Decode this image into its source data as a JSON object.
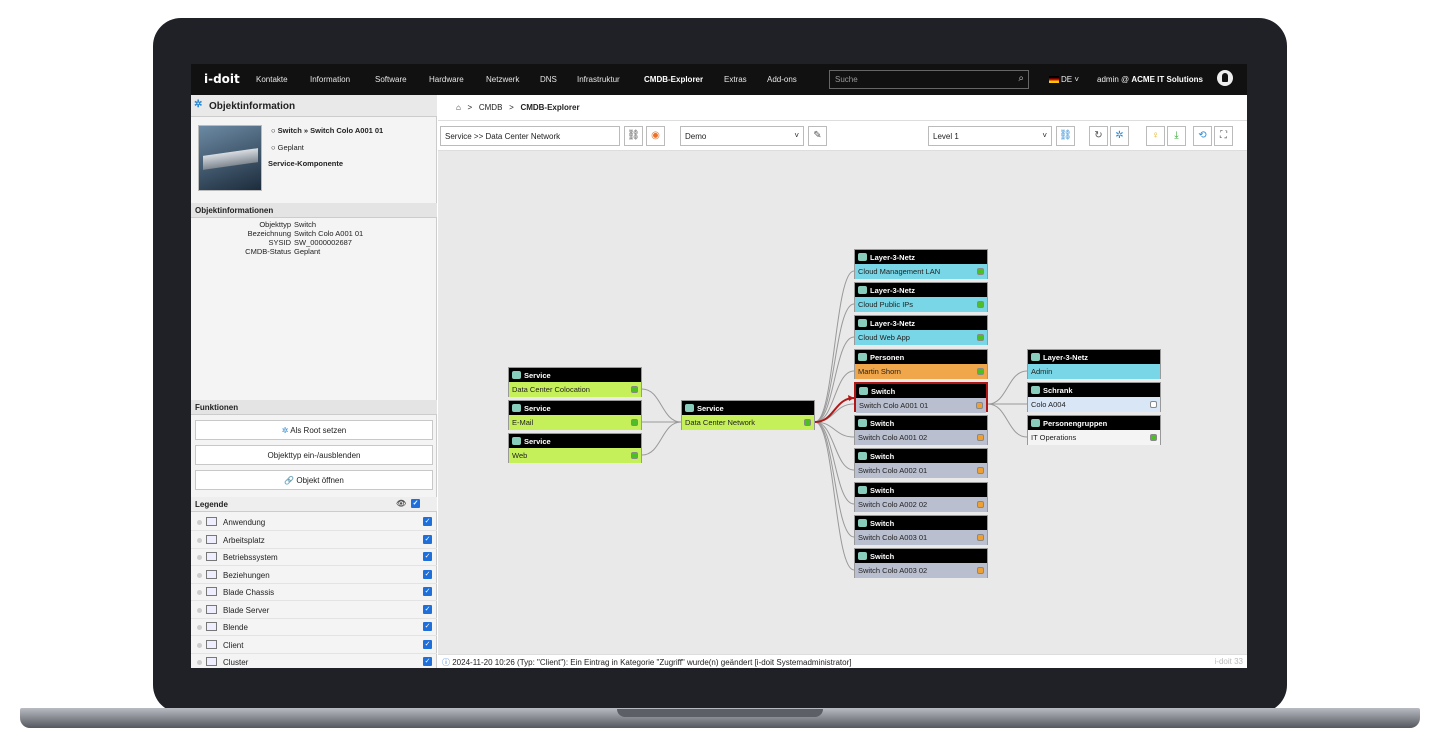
{
  "nav": {
    "logo": "i-doit",
    "items": [
      "Kontakte",
      "Information",
      "Software",
      "Hardware",
      "Netzwerk",
      "DNS",
      "Infrastruktur",
      "CMDB-Explorer",
      "Extras",
      "Add-ons"
    ],
    "search_placeholder": "Suche",
    "lang": "DE",
    "user_prefix": "admin @",
    "user_org": "ACME IT Solutions"
  },
  "left": {
    "header": "Objektinformation",
    "object": {
      "title": "Switch » Switch Colo A001 01",
      "status": "Geplant",
      "type": "Service-Komponente"
    },
    "info_header": "Objektinformationen",
    "info": [
      {
        "k": "Objekttyp",
        "v": "Switch"
      },
      {
        "k": "Bezeichnung",
        "v": "Switch Colo A001 01"
      },
      {
        "k": "SYSID",
        "v": "SW_0000002687"
      },
      {
        "k": "CMDB-Status",
        "v": "Geplant"
      }
    ],
    "functions_header": "Funktionen",
    "buttons": [
      "Als Root setzen",
      "Objekttyp ein-/ausblenden",
      "Objekt öffnen"
    ],
    "legend_header": "Legende",
    "legend": [
      "Anwendung",
      "Arbeitsplatz",
      "Betriebssystem",
      "Beziehungen",
      "Blade Chassis",
      "Blade Server",
      "Blende",
      "Client",
      "Cluster"
    ]
  },
  "breadcrumb": {
    "items": [
      "CMDB",
      "CMDB-Explorer"
    ]
  },
  "toolbar": {
    "path": "Service >> Data Center Network",
    "profile": "Demo",
    "level": "Level 1"
  },
  "nodes": [
    {
      "type": "Service",
      "name": "Data Center Colocation",
      "color": "#c5f05a",
      "status": "#4cbf22"
    },
    {
      "type": "Service",
      "name": "E-Mail",
      "color": "#c5f05a",
      "status": "#4cbf22"
    },
    {
      "type": "Service",
      "name": "Web",
      "color": "#c5f05a",
      "status": "#4cbf22"
    },
    {
      "type": "Service",
      "name": "Data Center Network",
      "color": "#c5f05a",
      "status": "#4cbf22"
    },
    {
      "type": "Layer-3-Netz",
      "name": "Cloud Management LAN",
      "color": "#79d6e6",
      "status": "#4cbf22"
    },
    {
      "type": "Layer-3-Netz",
      "name": "Cloud Public IPs",
      "color": "#79d6e6",
      "status": "#4cbf22"
    },
    {
      "type": "Layer-3-Netz",
      "name": "Cloud Web App",
      "color": "#79d6e6",
      "status": "#4cbf22"
    },
    {
      "type": "Personen",
      "name": "Martin Shorn",
      "color": "#f0a64a",
      "status": "#4cbf22"
    },
    {
      "type": "Switch",
      "name": "Switch Colo A001 01",
      "color": "#b9bfcf",
      "status": "#f0a030"
    },
    {
      "type": "Switch",
      "name": "Switch Colo A001 02",
      "color": "#b9bfcf",
      "status": "#f0a030"
    },
    {
      "type": "Switch",
      "name": "Switch Colo A002 01",
      "color": "#b9bfcf",
      "status": "#f0a030"
    },
    {
      "type": "Switch",
      "name": "Switch Colo A002 02",
      "color": "#b9bfcf",
      "status": "#f0a030"
    },
    {
      "type": "Switch",
      "name": "Switch Colo A003 01",
      "color": "#b9bfcf",
      "status": "#f0a030"
    },
    {
      "type": "Switch",
      "name": "Switch Colo A003 02",
      "color": "#b9bfcf",
      "status": "#f0a030"
    },
    {
      "type": "Layer-3-Netz",
      "name": "Admin",
      "color": "#79d6e6",
      "status": ""
    },
    {
      "type": "Schrank",
      "name": "Colo A004",
      "color": "#d8e6f6",
      "status": "#ffffff"
    },
    {
      "type": "Personengruppen",
      "name": "IT Operations",
      "color": "#f4f4f4",
      "status": "#4cbf22"
    }
  ],
  "status_bar": {
    "message": "2024-11-20 10:26 (Typ: \"Client\"): Ein Eintrag in Kategorie \"Zugriff\" wurde(n) geändert [i-doit Systemadministrator]",
    "version": "i-doit 33"
  }
}
